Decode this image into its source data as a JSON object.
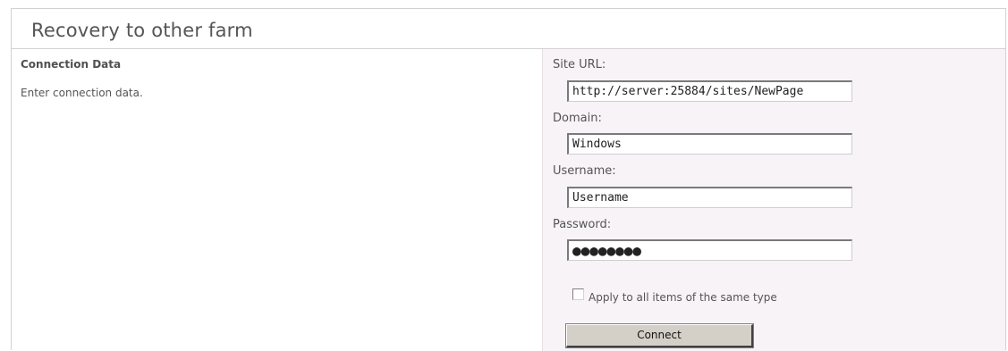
{
  "page": {
    "title": "Recovery to other farm"
  },
  "section": {
    "title": "Connection Data",
    "description": "Enter connection data."
  },
  "form": {
    "site_url": {
      "label": "Site URL:",
      "value": "http://server:25884/sites/NewPage"
    },
    "domain": {
      "label": "Domain:",
      "value": "Windows"
    },
    "username": {
      "label": "Username:",
      "value": "Username"
    },
    "password": {
      "label": "Password:",
      "value": "●●●●●●●●"
    },
    "apply_all": {
      "label": "Apply to all items of the same type",
      "checked": false
    },
    "connect_label": "Connect"
  }
}
